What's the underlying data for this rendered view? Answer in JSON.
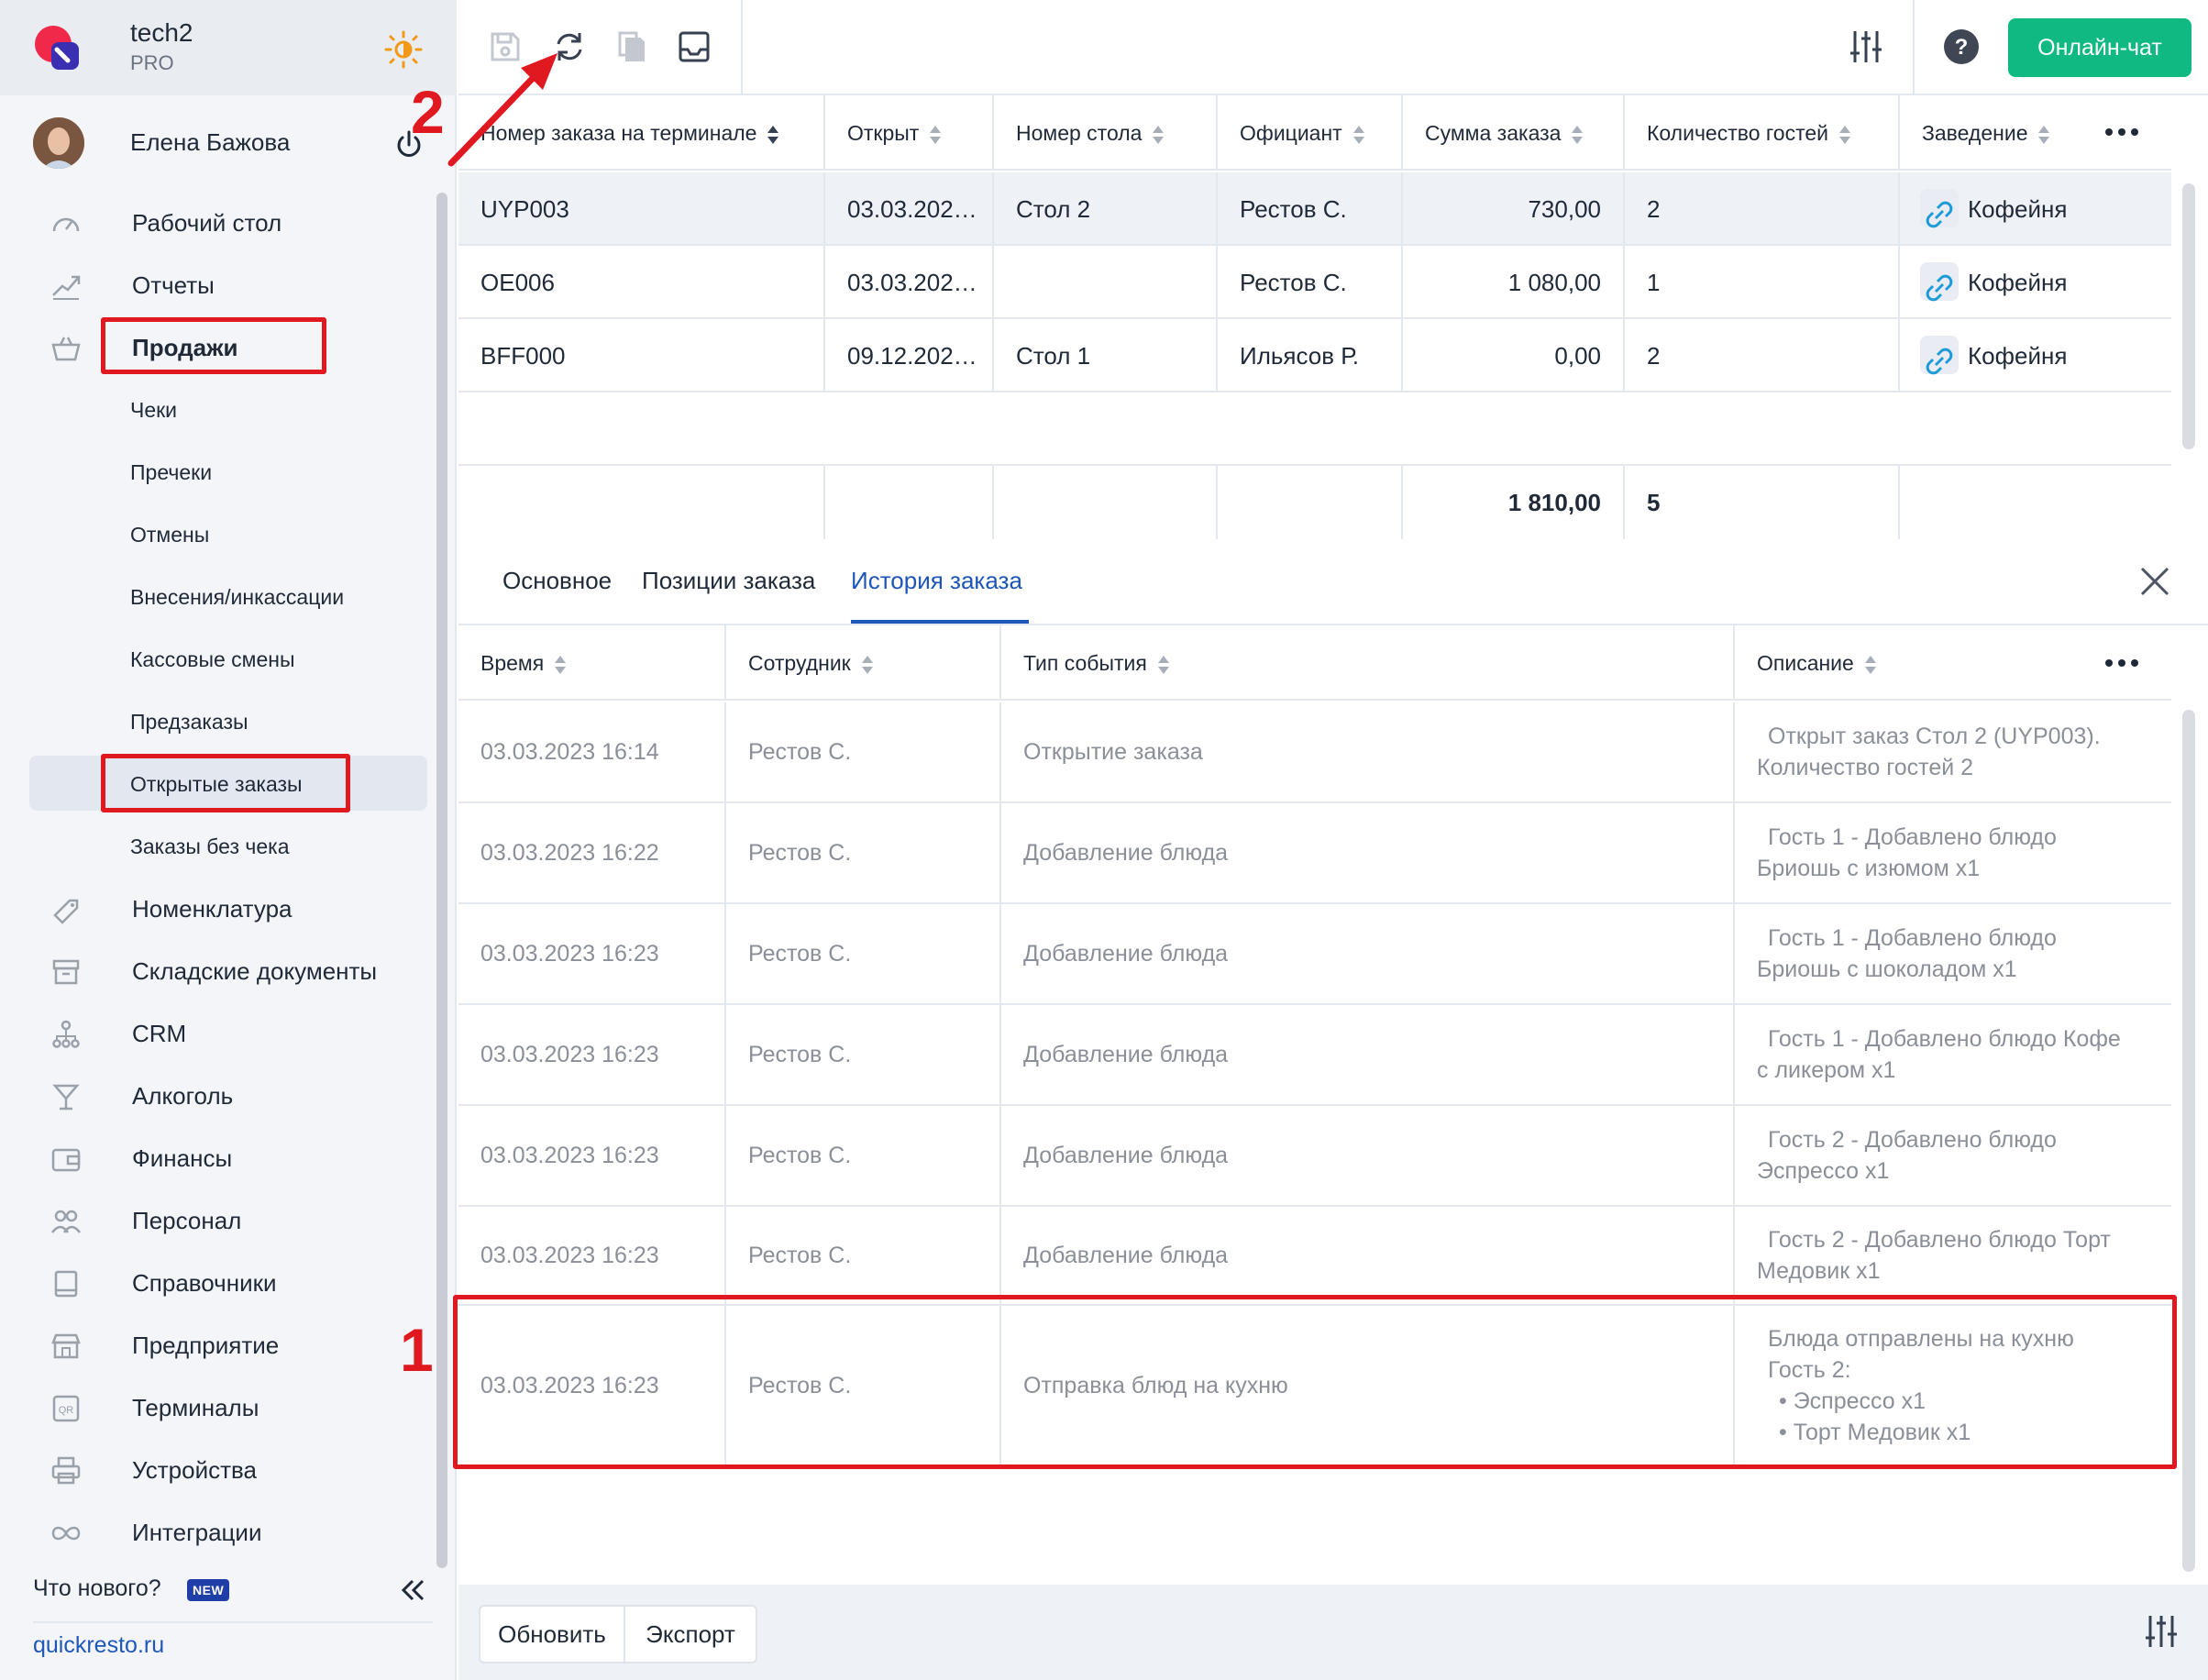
{
  "brand": {
    "name": "tech2",
    "plan": "PRO"
  },
  "user": {
    "name": "Елена Бажова"
  },
  "nav": {
    "desktop": "Рабочий стол",
    "reports": "Отчеты",
    "sales": "Продажи",
    "sales_sub": [
      "Чеки",
      "Пречеки",
      "Отмены",
      "Внесения/инкассации",
      "Кассовые смены",
      "Предзаказы",
      "Открытые заказы",
      "Заказы без чека"
    ],
    "nomenclature": "Номенклатура",
    "warehouse": "Складские документы",
    "crm": "CRM",
    "alcohol": "Алкоголь",
    "finance": "Финансы",
    "staff": "Персонал",
    "refs": "Справочники",
    "enterprise": "Предприятие",
    "terminals": "Терминалы",
    "devices": "Устройства",
    "integrations": "Интеграции"
  },
  "footer": {
    "whats_new": "Что нового?",
    "badge": "NEW",
    "site": "quickresto.ru"
  },
  "toolbar": {
    "chat": "Онлайн-чат"
  },
  "orders": {
    "headers": [
      "Номер заказа на терминале",
      "Открыт",
      "Номер стола",
      "Официант",
      "Сумма заказа",
      "Количество гостей",
      "Заведение"
    ],
    "rows": [
      [
        "UYP003",
        "03.03.202…",
        "Стол 2",
        "Рестов С.",
        "730,00",
        "2",
        "Кофейня"
      ],
      [
        "OE006",
        "03.03.202…",
        "",
        "Рестов С.",
        "1 080,00",
        "1",
        "Кофейня"
      ],
      [
        "BFF000",
        "09.12.202…",
        "Стол 1",
        "Ильясов Р.",
        "0,00",
        "2",
        "Кофейня"
      ]
    ],
    "totals": {
      "sum": "1 810,00",
      "guests": "5"
    }
  },
  "tabs": [
    "Основное",
    "Позиции заказа",
    "История заказа"
  ],
  "history": {
    "headers": [
      "Время",
      "Сотрудник",
      "Тип события",
      "Описание"
    ],
    "rows": [
      {
        "time": "03.03.2023 16:14",
        "employee": "Рестов С.",
        "type": "Открытие заказа",
        "desc": [
          "Открыт заказ Стол 2 (UYP003).",
          "Количество гостей 2"
        ]
      },
      {
        "time": "03.03.2023 16:22",
        "employee": "Рестов С.",
        "type": "Добавление блюда",
        "desc": [
          "Гость 1 - Добавлено блюдо",
          "Бриошь с изюмом x1"
        ]
      },
      {
        "time": "03.03.2023 16:23",
        "employee": "Рестов С.",
        "type": "Добавление блюда",
        "desc": [
          "Гость 1 - Добавлено блюдо",
          "Бриошь с шоколадом x1"
        ]
      },
      {
        "time": "03.03.2023 16:23",
        "employee": "Рестов С.",
        "type": "Добавление блюда",
        "desc": [
          "Гость 1 - Добавлено блюдо Кофе",
          "с ликером x1"
        ]
      },
      {
        "time": "03.03.2023 16:23",
        "employee": "Рестов С.",
        "type": "Добавление блюда",
        "desc": [
          "Гость 2 - Добавлено блюдо",
          "Эспрессо x1"
        ]
      },
      {
        "time": "03.03.2023 16:23",
        "employee": "Рестов С.",
        "type": "Добавление блюда",
        "desc": [
          "Гость 2 - Добавлено блюдо Торт",
          "Медовик x1"
        ]
      },
      {
        "time": "03.03.2023 16:23",
        "employee": "Рестов С.",
        "type": "Отправка блюд на кухню",
        "desc": [
          "Блюда отправлены на кухню",
          "Гость 2:",
          "• Эспрессо x1",
          "• Торт Медовик x1"
        ]
      }
    ]
  },
  "bottom": {
    "refresh": "Обновить",
    "export": "Экспорт"
  },
  "annotations": {
    "one": "1",
    "two": "2"
  },
  "colors": {
    "accent": "#1d56b8",
    "chat": "#10b981",
    "highlight": "#e01820"
  }
}
